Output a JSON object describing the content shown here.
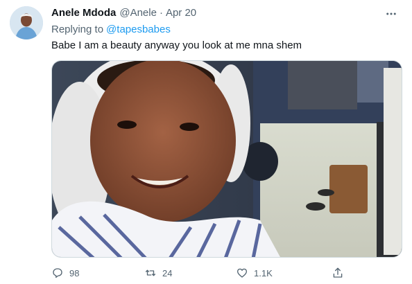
{
  "tweet": {
    "author_name": "Anele Mdoda",
    "handle": "@Anele",
    "separator": "·",
    "date": "Apr 20",
    "replying_prefix": "Replying to",
    "replying_to": "@tapesbabes",
    "text": "Babe I am a beauty anyway you look at me mna shem",
    "media_icon": "photo",
    "more_icon": "more-horizontal-icon"
  },
  "actions": {
    "reply_count": "98",
    "retweet_count": "24",
    "like_count": "1.1K",
    "reply_icon": "reply-icon",
    "retweet_icon": "retweet-icon",
    "like_icon": "heart-icon",
    "share_icon": "share-icon"
  },
  "colors": {
    "link": "#1d9bf0",
    "secondary_text": "#536471",
    "primary_text": "#0f1419"
  }
}
